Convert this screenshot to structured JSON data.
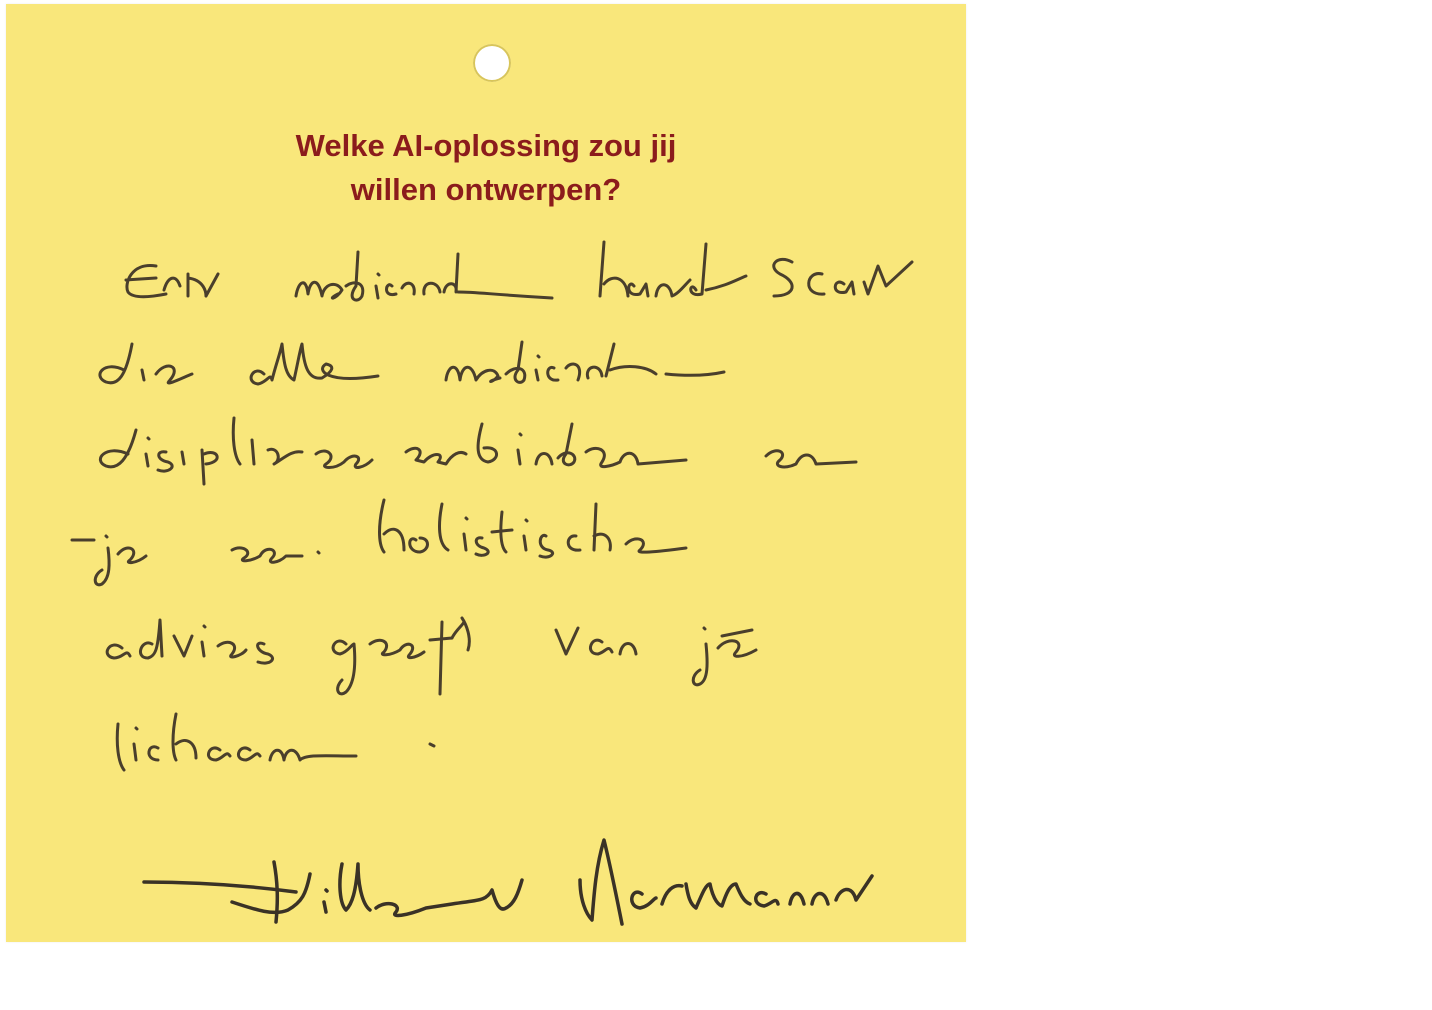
{
  "card": {
    "question_line1": "Welke AI-oplossing zou jij",
    "question_line2": "willen ontwerpen?",
    "answer_lines": [
      "Een medische handscan",
      "die alle medische",
      "disciplines verbinden en",
      "je een holistische",
      "advies geeft van je",
      "lichaam ."
    ],
    "signature": "Hilla Neumann",
    "colors": {
      "card_background": "#f9e77b",
      "question_text": "#8b1c1c",
      "ink": "#4a3f2c"
    }
  }
}
